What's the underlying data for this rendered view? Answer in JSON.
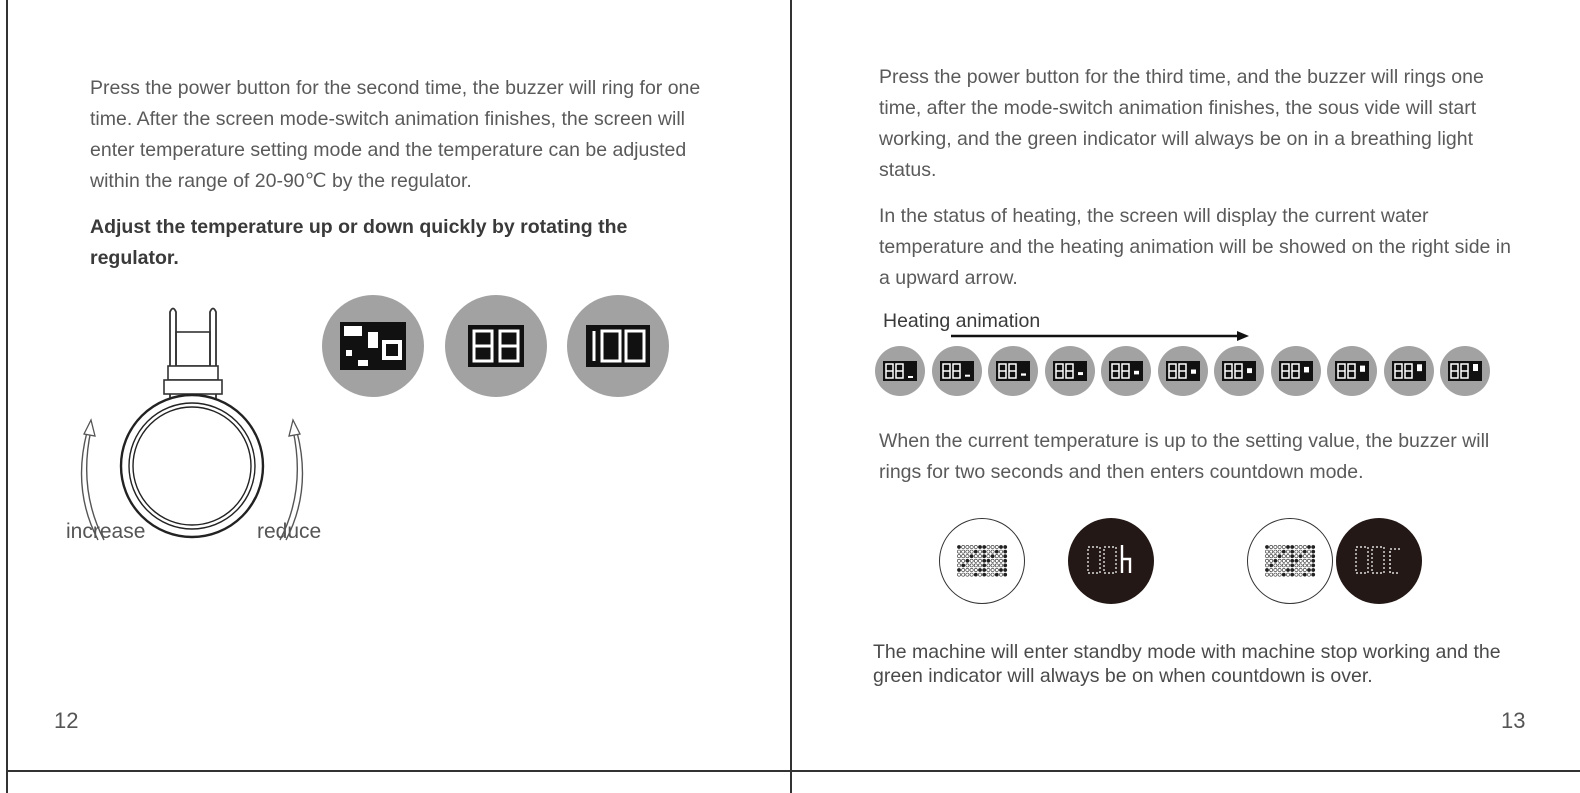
{
  "left_page": {
    "paragraph_1": "Press the power button for the second time, the buzzer will ring for one time. After the screen mode-switch animation finishes, the screen will enter temperature setting mode and the temperature can be adjusted within the range of 20-90℃ by the regulator.",
    "paragraph_bold": "Adjust the temperature up or down quickly by rotating the regulator.",
    "dial": {
      "increase_label": "increase",
      "reduce_label": "reduce"
    },
    "page_number": "12"
  },
  "right_page": {
    "paragraph_1": "Press the power button for the third time, and the buzzer will rings one time, after the mode-switch animation finishes, the sous vide will start working, and the green indicator will always be on in a breathing light status.",
    "paragraph_2": "In the status of heating, the screen will display the current water temperature and the heating animation will be showed on the right side in a upward arrow.",
    "heating_animation_label": "Heating animation",
    "paragraph_3": "When the current temperature is up to the setting value, the buzzer will rings for two seconds and then enters countdown mode.",
    "paragraph_4": "The machine will enter standby mode with machine stop working and the green indicator will always be on when countdown is over.",
    "page_number": "13"
  },
  "icons": {
    "regulator": "dial-icon",
    "arrow": "curved-arrow-icon",
    "display": "dot-matrix-display-icon"
  },
  "colors": {
    "text": "#5a5a5a",
    "display_gray": "#a2a2a2",
    "display_black": "#231815"
  }
}
